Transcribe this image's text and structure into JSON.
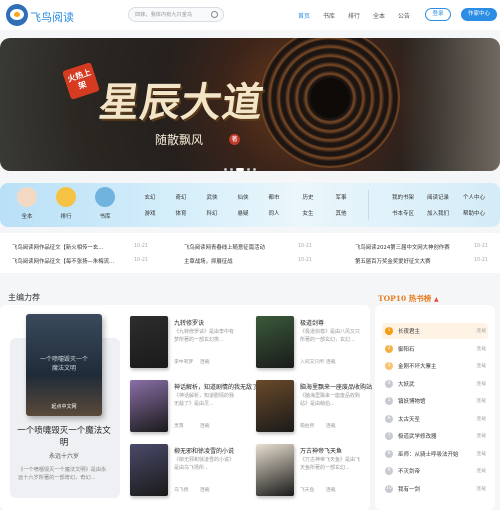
{
  "header": {
    "brand": "飞鸟阅读",
    "search_placeholder": "四妹，我体内有九只金乌",
    "nav": [
      "首页",
      "书库",
      "排行",
      "全本",
      "公告"
    ],
    "login": "登录",
    "author_center": "作家中心",
    "accent": "#2b8de3"
  },
  "banner": {
    "badge": "火热上架",
    "title": "星辰大道",
    "author": "随散飘风",
    "seal": "著"
  },
  "quick_nav": {
    "items": [
      "全本",
      "排行",
      "书库"
    ],
    "categories": [
      "玄幻",
      "奇幻",
      "武侠",
      "仙侠",
      "都市",
      "历史",
      "军事",
      "游戏",
      "体育",
      "科幻",
      "悬疑",
      "同人",
      "女生",
      "其他"
    ],
    "links": [
      "我的书架",
      "阅读记录",
      "个人中心",
      "书本专区",
      "加入我们",
      "帮助中心"
    ]
  },
  "news": [
    {
      "title": "飞鸟阅读网作品征文【新火相传一玄...",
      "date": "10-21"
    },
    {
      "title": "飞鸟阅读网青春线上随意征篇活动",
      "date": "10-21"
    },
    {
      "title": "飞鸟阅读2024第三届中文网大神创作赛",
      "date": "10-21"
    },
    {
      "title": "飞鸟阅读网作品征文【每不张扬—朱梅流...",
      "date": "10-21"
    },
    {
      "title": "主章战场，抑展征战",
      "date": "10-21"
    },
    {
      "title": "第五届百万奖金奖爱好征文大赛",
      "date": "10-21"
    }
  ],
  "main": {
    "section_title": "主编力荐",
    "featured": {
      "cover_text": "一个喷嚏毁灭一个魔法文明",
      "cover_publisher": "起点中文网",
      "title": "一个喷嚏毁灭一个魔法文明",
      "author": "永远十六岁",
      "desc": "《一个喷嚏毁灭一个魔法文明》是由永远十六岁所著的一部奇幻，奇幻..."
    },
    "books": [
      {
        "title": "九转修罗诀",
        "desc": "《九转修罗诀》是由李中有梦所著的一部玄幻类...",
        "author": "李中有梦",
        "cat": "连载",
        "color": "#2d2d2d"
      },
      {
        "title": "极道剑尊",
        "desc": "《极道剑尊》是由八风又只所著的一部玄幻，玄幻...",
        "author": "入间又只所",
        "cat": "连载",
        "color": "#3a5a3a"
      },
      {
        "title": "神话解析，知道剧情的我无敌了",
        "desc": "《神话解析，知道剧情的我无敌了》是由灵...",
        "author": "灵落",
        "cat": "连载",
        "color": "#8a6fa8"
      },
      {
        "title": "脑海里飘来一座废品收购站",
        "desc": "《脑海里飘来一座废品收购站》是由萌伯...",
        "author": "萌伯所",
        "cat": "连载",
        "color": "#6a4a2a"
      },
      {
        "title": "柳无邪和徐凌雪的小说",
        "desc": "《柳无邪和徐凌雪的小说》是由乌飞扬所...",
        "author": "乌飞扬",
        "cat": "连载",
        "color": "#4a4a6a"
      },
      {
        "title": "万古神帝飞天鱼",
        "desc": "《万古神帝飞天鱼》是由飞天鱼所著的一部玄幻...",
        "author": "飞天鱼",
        "cat": "连载",
        "color": "#e8e0d0"
      }
    ]
  },
  "ranking": {
    "title": "TOP10 热书榜",
    "items": [
      {
        "name": "长夜君主",
        "cat": "连载"
      },
      {
        "name": "御阳石",
        "cat": "连载"
      },
      {
        "name": "金刚不坏大寨主",
        "cat": "连载"
      },
      {
        "name": "大妖武",
        "cat": "连载"
      },
      {
        "name": "镇妖博物馆",
        "cat": "连载"
      },
      {
        "name": "太古天圣",
        "cat": "连载"
      },
      {
        "name": "极道武学修改器",
        "cat": "连载"
      },
      {
        "name": "巫师：从骑士呼吸法开始",
        "cat": "连载"
      },
      {
        "name": "不灭剑帝",
        "cat": "连载"
      },
      {
        "name": "我有一剑",
        "cat": "连载"
      }
    ]
  }
}
